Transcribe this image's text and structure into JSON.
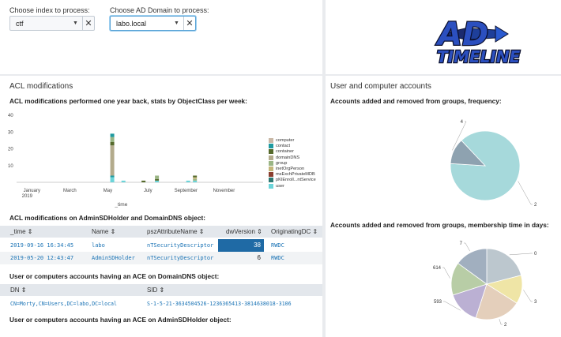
{
  "filters": {
    "index": {
      "label": "Choose index to process:",
      "value": "ctf"
    },
    "domain": {
      "label": "Choose AD Domain to process:",
      "value": "labo.local"
    },
    "clear_glyph": "✕",
    "caret_glyph": "▼"
  },
  "logo": {
    "line1": "AD",
    "line2": "TIMELINE"
  },
  "acl_panel": {
    "title": "ACL modifications",
    "chart_title": "ACL modifications performed one year back, stats by ObjectClass per week:",
    "table1_title": "ACL modifications on AdminSDHolder and DomainDNS object:",
    "table1": {
      "columns": [
        "_time ⇕",
        "Name ⇕",
        "pszAttributeName ⇕",
        "dwVersion ⇕",
        "OriginatingDC ⇕"
      ],
      "rows": [
        [
          "2019-09-16 16:34:45",
          "labo",
          "nTSecurityDescriptor",
          "38",
          "RWDC"
        ],
        [
          "2019-05-20 12:43:47",
          "AdminSDHolder",
          "nTSecurityDescriptor",
          "6",
          "RWDC"
        ]
      ]
    },
    "table2_title": "User or computers accounts having an ACE on DomainDNS object:",
    "table2": {
      "columns": [
        "DN ⇕",
        "SID ⇕"
      ],
      "rows": [
        [
          "CN=Morty,CN=Users,DC=labo,DC=local",
          "S-1-5-21-3634504526-1236365413-3814638018-3106"
        ]
      ]
    },
    "table3_title": "User or computers accounts having an ACE on AdminSDHolder object:"
  },
  "accounts_panel": {
    "title": "User and computer accounts",
    "pie1_title": "Accounts added and removed from groups, frequency:",
    "pie2_title": "Accounts added and removed from groups, membership time in days:"
  },
  "colors": {
    "highlight": "#1f6aa5",
    "link": "#1a73b5",
    "computer": "#c9b8a6",
    "contact": "#1e9aa0",
    "container": "#566a2c",
    "domainDNS": "#b3ab8c",
    "group": "#9ab585",
    "inetOrgPerson": "#c3b67a",
    "msExchPrivateMDB": "#8a3e2f",
    "pKIEnrollmentService": "#2e7a73",
    "user": "#6cd4d9"
  },
  "chart_data": [
    {
      "type": "bar",
      "stacked": true,
      "title": "ACL modifications performed one year back, stats by ObjectClass per week:",
      "xlabel": "_time",
      "ylabel": "",
      "ylim": [
        0,
        40
      ],
      "yticks": [
        "40",
        "30",
        "20",
        "10"
      ],
      "x_ticks": [
        {
          "label": "January",
          "sub": "2019"
        },
        {
          "label": "March",
          "sub": ""
        },
        {
          "label": "May",
          "sub": ""
        },
        {
          "label": "July",
          "sub": ""
        },
        {
          "label": "September",
          "sub": ""
        },
        {
          "label": "November",
          "sub": ""
        }
      ],
      "legend_position": "right",
      "series_names": [
        "computer",
        "contact",
        "container",
        "domainDNS",
        "group",
        "inetOrgPerson",
        "msExchPrivateMDB",
        "pKIEnroll...ntService",
        "user"
      ],
      "bars": [
        {
          "week": 20,
          "stack": [
            [
              "user",
              3
            ],
            [
              "contact",
              1
            ],
            [
              "domainDNS",
              18
            ],
            [
              "container",
              2
            ],
            [
              "group",
              3
            ],
            [
              "contact",
              2
            ]
          ]
        },
        {
          "week": 22.5,
          "stack": [
            [
              "user",
              1
            ]
          ]
        },
        {
          "week": 27,
          "stack": [
            [
              "container",
              1
            ]
          ]
        },
        {
          "week": 30,
          "stack": [
            [
              "user",
              1
            ],
            [
              "container",
              1
            ],
            [
              "group",
              2
            ]
          ]
        },
        {
          "week": 37,
          "stack": [
            [
              "user",
              1
            ]
          ]
        },
        {
          "week": 38.5,
          "stack": [
            [
              "user",
              1
            ],
            [
              "group",
              1
            ],
            [
              "inetOrgPerson",
              1
            ],
            [
              "container",
              1
            ]
          ]
        }
      ]
    },
    {
      "type": "pie",
      "title": "Accounts added and removed from groups, frequency:",
      "slices": [
        {
          "label": "2",
          "value": 88,
          "color": "#a6d9db"
        },
        {
          "label": "4",
          "value": 12,
          "color": "#8ea2b0"
        }
      ]
    },
    {
      "type": "pie",
      "title": "Accounts added and removed from groups, membership time in days:",
      "slices": [
        {
          "label": "0",
          "value": 21,
          "color": "#bcc7ce"
        },
        {
          "label": "3",
          "value": 13,
          "color": "#efe5a6"
        },
        {
          "label": "2",
          "value": 21,
          "color": "#e4cfbb"
        },
        {
          "label": "593",
          "value": 15,
          "color": "#bbb0d3"
        },
        {
          "label": "614",
          "value": 15,
          "color": "#b8cda6"
        },
        {
          "label": "7",
          "value": 15,
          "color": "#a1afbf"
        }
      ]
    }
  ]
}
